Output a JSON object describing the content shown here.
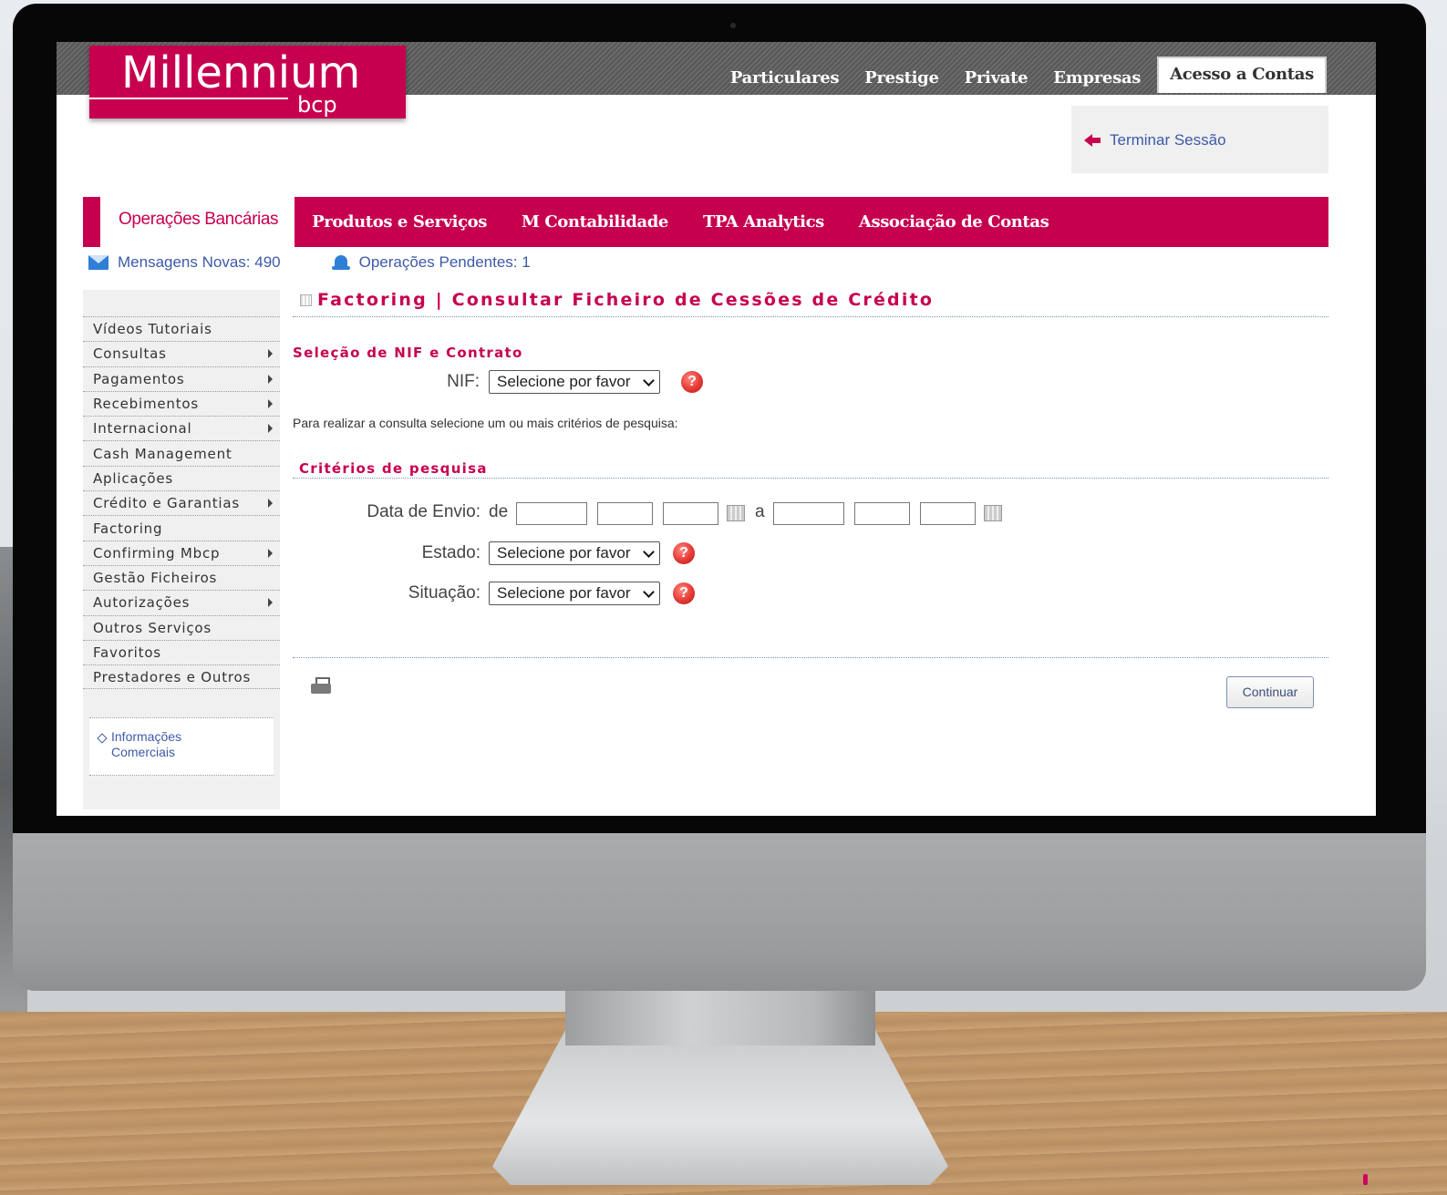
{
  "brand": {
    "logo_main": "Millennium",
    "logo_sub": "bcp",
    "color": "#c6004f"
  },
  "top_nav": {
    "items": [
      "Particulares",
      "Prestige",
      "Private",
      "Empresas"
    ],
    "active": "Acesso a Contas"
  },
  "session": {
    "logout_label": "Terminar Sessão"
  },
  "main_nav": {
    "active": "Operações Bancárias",
    "items": [
      "Produtos e Serviços",
      "M Contabilidade",
      "TPA Analytics",
      "Associação de Contas"
    ]
  },
  "status": {
    "messages": "Mensagens Novas: 490",
    "pending": "Operações Pendentes: 1"
  },
  "sidebar": {
    "items": [
      {
        "label": "Vídeos Tutoriais",
        "submenu": false
      },
      {
        "label": "Consultas",
        "submenu": true
      },
      {
        "label": "Pagamentos",
        "submenu": true
      },
      {
        "label": "Recebimentos",
        "submenu": true
      },
      {
        "label": "Internacional",
        "submenu": true
      },
      {
        "label": "Cash Management",
        "submenu": false
      },
      {
        "label": "Aplicações",
        "submenu": false
      },
      {
        "label": "Crédito e Garantias",
        "submenu": true
      },
      {
        "label": "Factoring",
        "submenu": false
      },
      {
        "label": "Confirming Mbcp",
        "submenu": true
      },
      {
        "label": "Gestão Ficheiros",
        "submenu": false
      },
      {
        "label": "Autorizações",
        "submenu": true
      },
      {
        "label": "Outros Serviços",
        "submenu": false
      },
      {
        "label": "Favoritos",
        "submenu": false
      },
      {
        "label": "Prestadores e Outros",
        "submenu": false
      }
    ],
    "info_link": "Informações Comerciais"
  },
  "page": {
    "title": "Factoring | Consultar Ficheiro de Cessões de Crédito",
    "section_nif": "Seleção de NIF e Contrato",
    "nif_label": "NIF:",
    "nif_value": "Selecione por favor",
    "hint": "Para realizar a consulta selecione um ou mais critérios de pesquisa:",
    "section_criteria": "Critérios de pesquisa",
    "date_label": "Data de Envio:",
    "date_from": "de",
    "date_to": "a",
    "estado_label": "Estado:",
    "estado_value": "Selecione por favor",
    "situacao_label": "Situação:",
    "situacao_value": "Selecione por favor",
    "continue_label": "Continuar",
    "help_glyph": "?"
  }
}
